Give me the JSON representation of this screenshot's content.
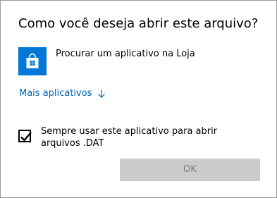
{
  "dialog": {
    "title": "Como você deseja abrir este arquivo?",
    "store_option": {
      "label": "Procurar um aplicativo na Loja",
      "icon": "store-icon"
    },
    "more_apps": {
      "label": "Mais aplicativos",
      "icon": "arrow-down-icon"
    },
    "always_use": {
      "label": "Sempre usar este aplicativo para abrir arquivos .DAT",
      "checked": true
    },
    "ok_button": {
      "label": "OK",
      "enabled": false
    }
  },
  "colors": {
    "accent": "#0078d7",
    "link": "#0063b1",
    "disabled_button_bg": "#cccccc",
    "disabled_button_text": "#7a7a7a"
  }
}
